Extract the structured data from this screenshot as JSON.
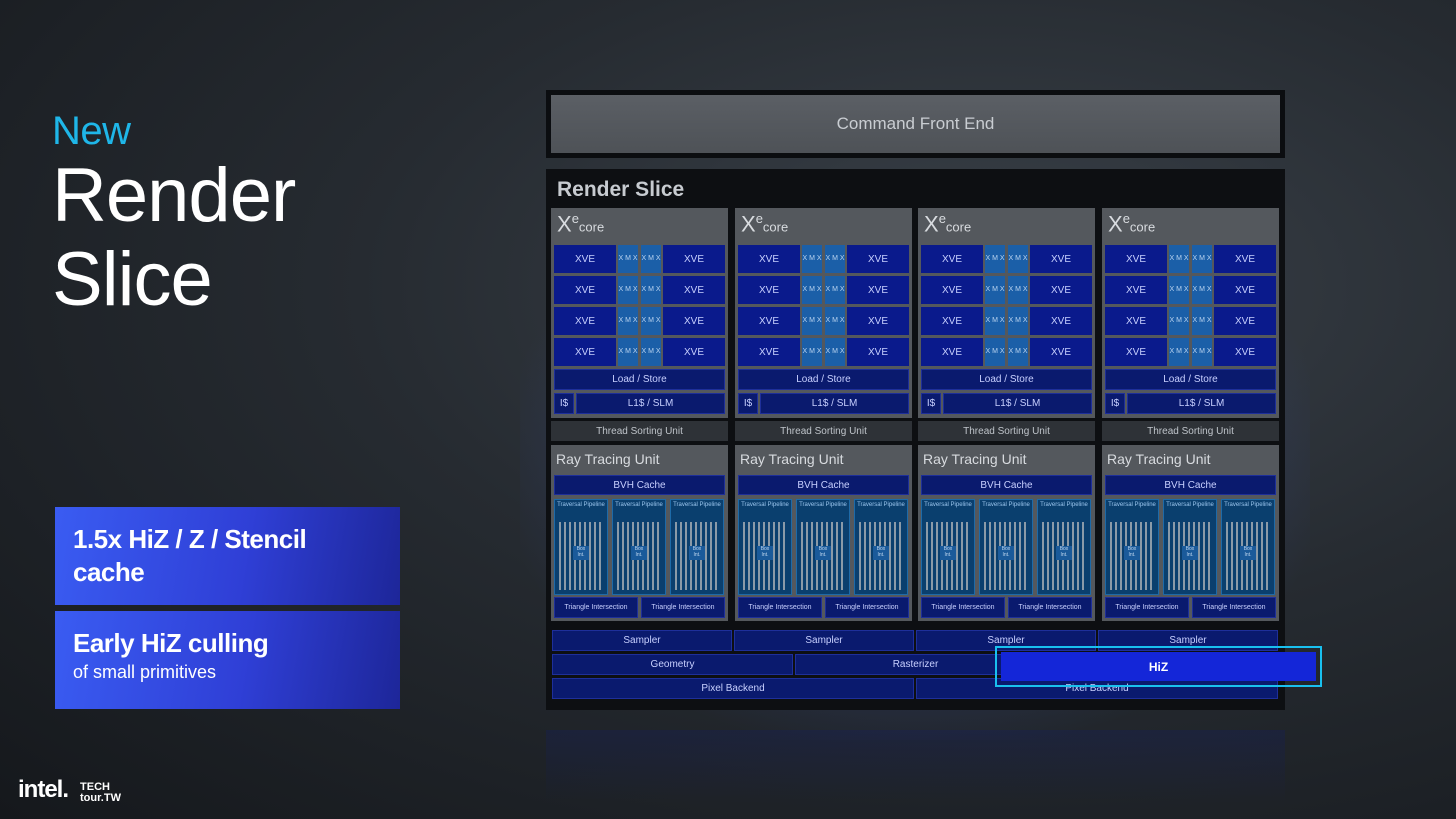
{
  "heading": {
    "kicker": "New",
    "title_line1": "Render",
    "title_line2": "Slice"
  },
  "features": [
    {
      "heading": "1.5x HiZ / Z / Stencil cache",
      "sub": ""
    },
    {
      "heading": "Early HiZ culling",
      "sub": "of small primitives"
    }
  ],
  "logo": {
    "brand": "intel.",
    "event_line1": "TECH",
    "event_line2": "tour.TW"
  },
  "diagram": {
    "command_front_end": "Command Front End",
    "slice_title": "Render Slice",
    "xe_core": {
      "x": "X",
      "e": "e",
      "core": "core"
    },
    "xve": "XVE",
    "xmx": "X M X",
    "load_store": "Load / Store",
    "icache": "I$",
    "l1_slm": "L1$ / SLM",
    "thread_sorting": "Thread Sorting Unit",
    "ray_tracing": "Ray Tracing Unit",
    "bvh_cache": "BVH Cache",
    "traversal": "Traversal Pipeline",
    "box_int": "Box Int.",
    "triangle": "Triangle Intersection",
    "sampler": "Sampler",
    "geometry": "Geometry",
    "rasterizer": "Rasterizer",
    "hiz": "HiZ",
    "pixel_backend": "Pixel Backend"
  },
  "colors": {
    "accent_cyan": "#19c0ef",
    "feature_blue": "#3a5cf2",
    "block_navy": "#0a1a8c",
    "hiz_blue": "#1426d8"
  }
}
